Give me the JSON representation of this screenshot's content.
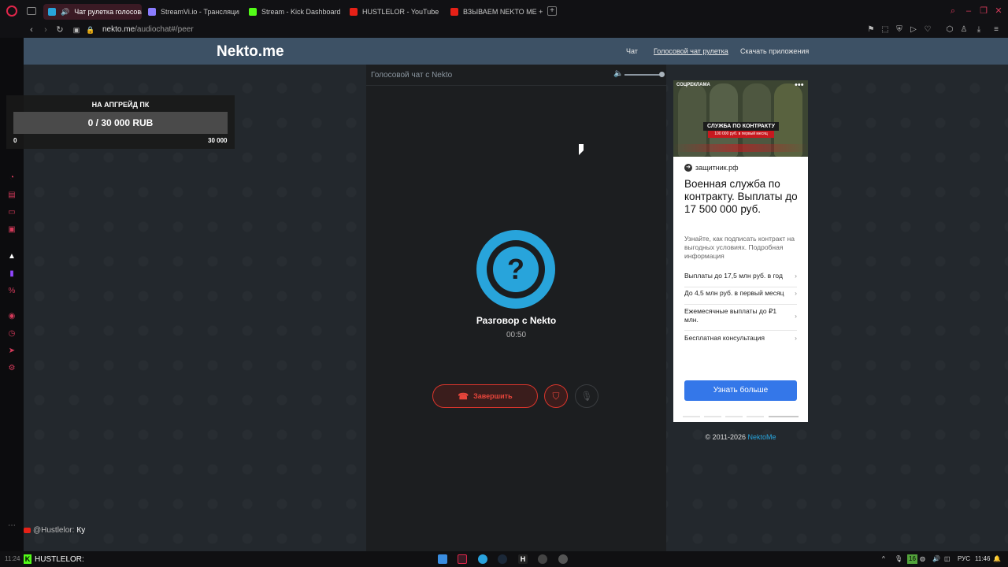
{
  "browser": {
    "tabs": [
      {
        "label": "Чат рулетка голосова",
        "active": true,
        "favicon_color": "#28a4db"
      },
      {
        "label": "StreamVi.io - Трансляции",
        "active": false,
        "favicon_color": "#8a7cff"
      },
      {
        "label": "Stream - Kick Dashboard",
        "active": false,
        "favicon_color": "#53fc18"
      },
      {
        "label": "HUSTLELOR - YouTube",
        "active": false,
        "favicon_color": "#e62117"
      },
      {
        "label": "ВЗЫВАЕМ NEKTO ME + ОБ",
        "active": false,
        "favicon_color": "#e62117"
      }
    ],
    "url_host": "nekto.me",
    "url_path": "/audiochat#/peer"
  },
  "site": {
    "logo": "Nekto.me",
    "nav": [
      "Чат",
      "Голосовой чат рулетка",
      "Скачать приложения"
    ]
  },
  "voice": {
    "panel_title": "Голосовой чат с Nekto",
    "volume": 0.9,
    "avatar_glyph": "?",
    "peer_name": "Разговор с Nekto",
    "timer": "00:50",
    "end_label": "Завершить",
    "end_icon": "phone-hangup-icon",
    "accent": "#28a4db",
    "danger": "#e8453b"
  },
  "ad": {
    "badge": "СОЦРЕКЛАМА",
    "banner_title": "СЛУЖБА ПО КОНТРАКТУ",
    "banner_sub": "100 000 руб. в первый месяц",
    "domain": "защитник.рф",
    "headline": "Военная служба по контракту. Выплаты до 17 500 000 руб.",
    "description": "Узнайте, как подписать контракт на выгодных условиях. Подробная информация",
    "rows": [
      "Выплаты до 17,5 млн руб. в год",
      "До 4,5 млн руб. в первый месяц",
      "Ежемесячные выплаты до ₽1 млн.",
      "Бесплатная консультация"
    ],
    "cta": "Узнать больше"
  },
  "footer": {
    "copyright": "© 2011-2026",
    "brand": "NektoMe"
  },
  "donation": {
    "title": "НА АПГРЕЙД ПК",
    "bar_text": "0 / 30 000 RUB",
    "progress": 0,
    "min": "0",
    "max": "30 000"
  },
  "chat": {
    "user": "@Hustlelor:",
    "message": "Ку"
  },
  "taskbar": {
    "kick_label": "HUSTLELOR:",
    "lang": "РУС",
    "time": "11:46",
    "left_time": "11:24"
  }
}
